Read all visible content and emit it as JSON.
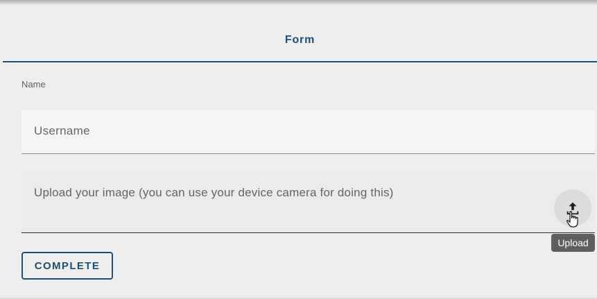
{
  "tab": {
    "label": "Form"
  },
  "form": {
    "name_label": "Name",
    "username_placeholder": "Username",
    "username_value": "",
    "upload_placeholder": "Upload your image (you can use your device camera for doing this)",
    "upload_icon": "upload-icon",
    "upload_tooltip": "Upload",
    "complete_label": "COMPLETE"
  },
  "colors": {
    "accent": "#1d4f76",
    "background": "#eeeeee",
    "tooltip_bg": "#5f5f5f"
  }
}
